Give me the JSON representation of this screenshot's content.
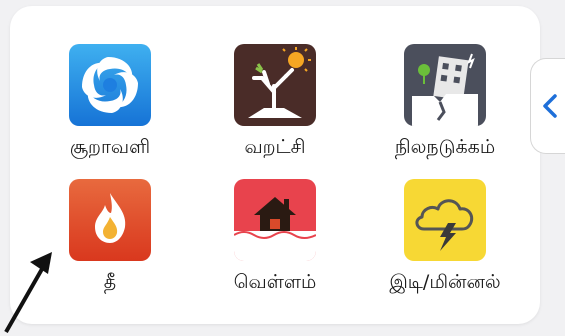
{
  "grid": {
    "items": [
      {
        "label": "சூறாவளி",
        "icon": "cyclone-icon",
        "bg": "#1e88e5"
      },
      {
        "label": "வறட்சி",
        "icon": "drought-icon",
        "bg": "#4a2c28"
      },
      {
        "label": "நிலநடுக்கம்",
        "icon": "earthquake-icon",
        "bg": "#4b4f5c"
      },
      {
        "label": "தீ",
        "icon": "fire-icon",
        "bg": "#e4572e"
      },
      {
        "label": "வெள்ளம்",
        "icon": "flood-icon",
        "bg": "#e8434d"
      },
      {
        "label": "இடி/மின்னல்",
        "icon": "thunder-lightning-icon",
        "bg": "#f7d834"
      }
    ]
  },
  "side_tab": {
    "icon": "chevron-left-icon",
    "color": "#1e6fd9"
  },
  "overlay": {
    "icon": "pointer-arrow-icon"
  }
}
